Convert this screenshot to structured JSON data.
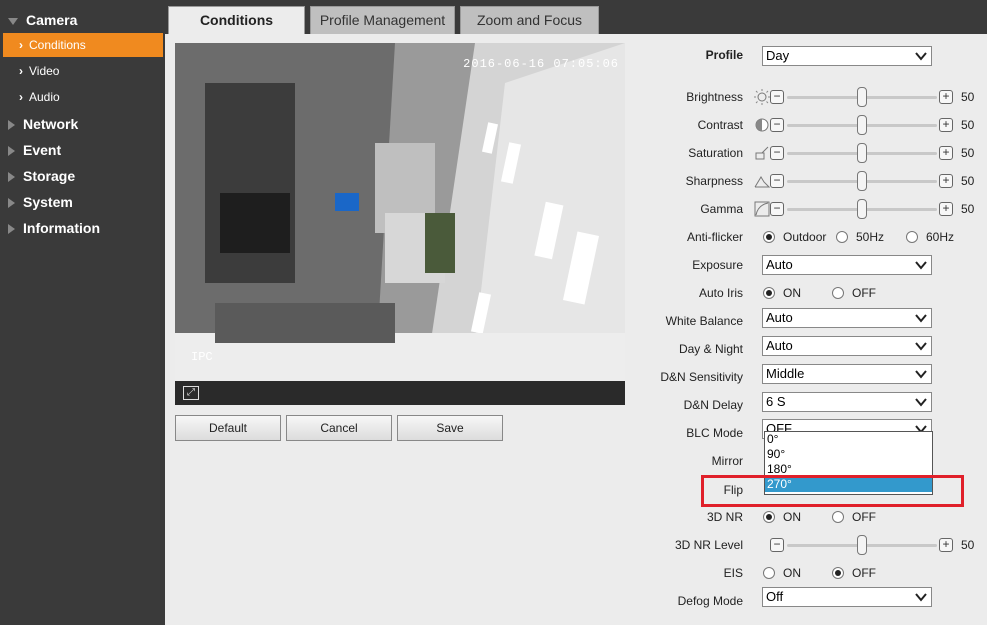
{
  "sidebar": {
    "camera": "Camera",
    "subitems": [
      {
        "label": "Conditions",
        "active": true
      },
      {
        "label": "Video"
      },
      {
        "label": "Audio"
      }
    ],
    "items": [
      {
        "label": "Network"
      },
      {
        "label": "Event"
      },
      {
        "label": "Storage"
      },
      {
        "label": "System"
      },
      {
        "label": "Information"
      }
    ]
  },
  "tabs": [
    {
      "label": "Conditions",
      "active": true
    },
    {
      "label": "Profile Management"
    },
    {
      "label": "Zoom and Focus"
    }
  ],
  "video": {
    "timestamp": "2016-06-16 07:05:06",
    "channel_name": "IPC"
  },
  "buttons": {
    "default": "Default",
    "cancel": "Cancel",
    "save": "Save"
  },
  "settings": {
    "profile": {
      "label": "Profile",
      "value": "Day"
    },
    "brightness": {
      "label": "Brightness",
      "value": 50,
      "icon": "sun-icon"
    },
    "contrast": {
      "label": "Contrast",
      "value": 50,
      "icon": "half-circle-icon"
    },
    "saturation": {
      "label": "Saturation",
      "value": 50,
      "icon": "paint-icon"
    },
    "sharpness": {
      "label": "Sharpness",
      "value": 50,
      "icon": "triangle-icon"
    },
    "gamma": {
      "label": "Gamma",
      "value": 50,
      "icon": "gamma-curve-icon"
    },
    "anti_flicker": {
      "label": "Anti-flicker",
      "options": [
        "Outdoor",
        "50Hz",
        "60Hz"
      ],
      "selected": "Outdoor"
    },
    "exposure": {
      "label": "Exposure",
      "value": "Auto"
    },
    "auto_iris": {
      "label": "Auto Iris",
      "options": [
        "ON",
        "OFF"
      ],
      "selected": "ON"
    },
    "white_balance": {
      "label": "White Balance",
      "value": "Auto"
    },
    "day_night": {
      "label": "Day & Night",
      "value": "Auto"
    },
    "dn_sensitivity": {
      "label": "D&N Sensitivity",
      "value": "Middle"
    },
    "dn_delay": {
      "label": "D&N Delay",
      "value": "6 S"
    },
    "blc_mode": {
      "label": "BLC Mode",
      "value": "OFF"
    },
    "mirror": {
      "label": "Mirror"
    },
    "flip": {
      "label": "Flip",
      "options": [
        "0°",
        "90°",
        "180°",
        "270°"
      ],
      "selected": "270°"
    },
    "nr3d": {
      "label": "3D NR",
      "options": [
        "ON",
        "OFF"
      ],
      "selected": "ON"
    },
    "nr3d_level": {
      "label": "3D NR Level",
      "value": 50
    },
    "eis": {
      "label": "EIS",
      "options": [
        "ON",
        "OFF"
      ],
      "selected": "OFF"
    },
    "defog_mode": {
      "label": "Defog Mode",
      "value": "Off"
    }
  },
  "colors": {
    "sidebar_bg": "#3a3a3a",
    "active_orange": "#f08a1f",
    "dropdown_highlight": "#3399cc",
    "annotation_red": "#e0202a"
  }
}
